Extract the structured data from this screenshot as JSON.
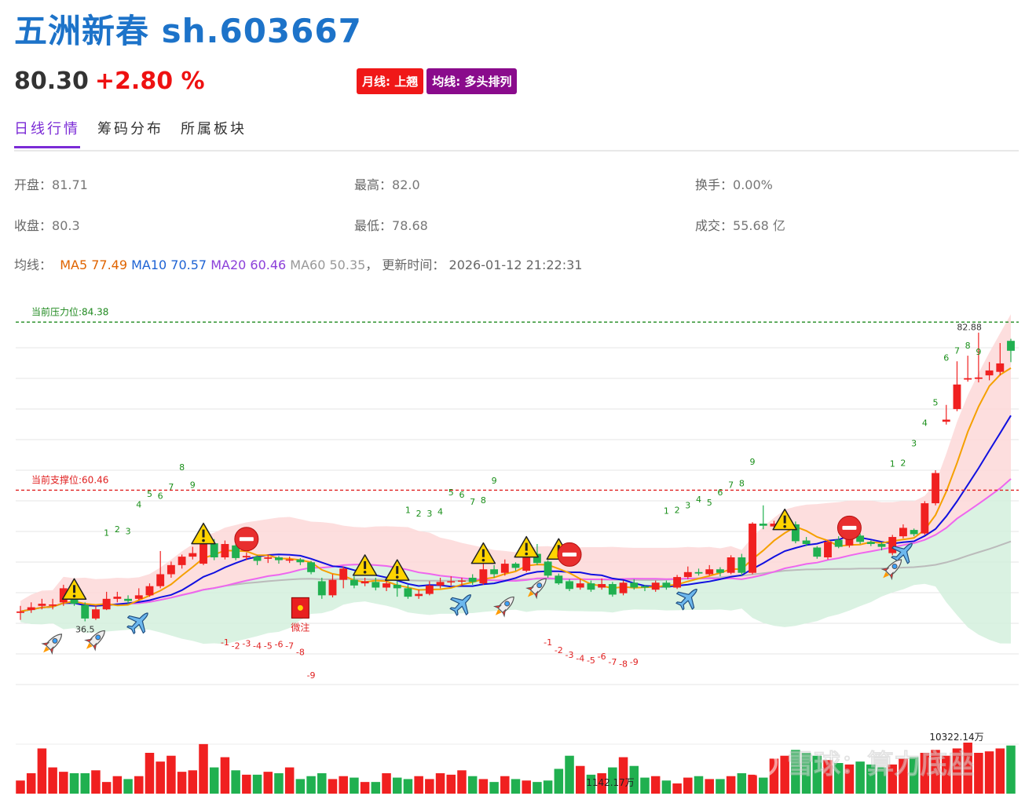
{
  "header": {
    "title": "五洲新春 sh.603667"
  },
  "quote": {
    "price": "80.30",
    "change": "+2.80 %"
  },
  "badges": [
    {
      "label": "月线: 上翘",
      "color": "#f01818"
    },
    {
      "label": "均线: 多头排列",
      "color": "#8a0b8c"
    }
  ],
  "tabs": [
    {
      "label": "日线行情"
    },
    {
      "label": "筹码分布"
    },
    {
      "label": "所属板块"
    }
  ],
  "stats": {
    "open_label": "开盘：",
    "open": "81.71",
    "high_label": "最高：",
    "high": "82.0",
    "turnover_label": "换手：",
    "turnover": "0.00%",
    "close_label": "收盘：",
    "close": "80.3",
    "low_label": "最低：",
    "low": "78.68",
    "amount_label": "成交：",
    "amount": "55.68 亿"
  },
  "ma": {
    "label": "均线：",
    "ma5": "MA5 77.49",
    "ma10": "MA10 70.57",
    "ma20": "MA20 60.46",
    "ma60": "MA60 50.35",
    "sep": "，",
    "update_label": "更新时间：",
    "update_time": "2026-01-12 21:22:31"
  },
  "colors": {
    "up": "#f02020",
    "down": "#20b050",
    "ma5": "#f5a000",
    "ma10": "#1010e0",
    "ma20": "#ee66ee",
    "ma60": "#bbbbbb",
    "resistance": "#208a20",
    "support": "#e02020"
  },
  "chart_data": {
    "type": "candlestick",
    "resistance_label": "当前压力位:84.38",
    "resistance": 84.38,
    "support_label": "当前支撑位:60.46",
    "support": 60.46,
    "y_range": [
      28,
      90
    ],
    "low_label": "36.5",
    "high_label": "82.88",
    "follow_label": "微注",
    "volume_max_label": "10322.14万",
    "volume_min_label": "1142.17万",
    "watermark": "雪球：算力底座",
    "nine_up": [
      {
        "text": "1",
        "i": 8,
        "v": 54
      },
      {
        "text": "2",
        "i": 9,
        "v": 54.5
      },
      {
        "text": "3",
        "i": 10,
        "v": 54.2
      },
      {
        "text": "4",
        "i": 11,
        "v": 58
      },
      {
        "text": "5",
        "i": 12,
        "v": 59.5
      },
      {
        "text": "6",
        "i": 13,
        "v": 59.2
      },
      {
        "text": "7",
        "i": 14,
        "v": 60.5
      },
      {
        "text": "8",
        "i": 15,
        "v": 63.3
      },
      {
        "text": "9",
        "i": 16,
        "v": 60.8
      },
      {
        "text": "1",
        "i": 36,
        "v": 57.2
      },
      {
        "text": "2",
        "i": 37,
        "v": 56.7
      },
      {
        "text": "3",
        "i": 38,
        "v": 56.7
      },
      {
        "text": "4",
        "i": 39,
        "v": 57
      },
      {
        "text": "5",
        "i": 40,
        "v": 59.7
      },
      {
        "text": "6",
        "i": 41,
        "v": 59.4
      },
      {
        "text": "7",
        "i": 42,
        "v": 58.4
      },
      {
        "text": "8",
        "i": 43,
        "v": 58.6
      },
      {
        "text": "9",
        "i": 44,
        "v": 61.4
      },
      {
        "text": "1",
        "i": 60,
        "v": 57.1
      },
      {
        "text": "2",
        "i": 61,
        "v": 57.2
      },
      {
        "text": "3",
        "i": 62,
        "v": 57.9
      },
      {
        "text": "4",
        "i": 63,
        "v": 58.7
      },
      {
        "text": "5",
        "i": 64,
        "v": 58.3
      },
      {
        "text": "6",
        "i": 65,
        "v": 59.7
      },
      {
        "text": "7",
        "i": 66,
        "v": 60.8
      },
      {
        "text": "8",
        "i": 67,
        "v": 61
      },
      {
        "text": "9",
        "i": 68,
        "v": 64.1
      },
      {
        "text": "1",
        "i": 81,
        "v": 63.8
      },
      {
        "text": "2",
        "i": 82,
        "v": 63.9
      },
      {
        "text": "3",
        "i": 83,
        "v": 66.7
      },
      {
        "text": "4",
        "i": 84,
        "v": 69.6
      },
      {
        "text": "5",
        "i": 85,
        "v": 72.5
      },
      {
        "text": "6",
        "i": 86,
        "v": 78.9
      },
      {
        "text": "7",
        "i": 87,
        "v": 79.9
      },
      {
        "text": "8",
        "i": 88,
        "v": 80.6
      },
      {
        "text": "9",
        "i": 89,
        "v": 79.7
      }
    ],
    "nine_down": [
      {
        "text": "-1",
        "i": 19,
        "v": 38.4
      },
      {
        "text": "-2",
        "i": 20,
        "v": 37.9
      },
      {
        "text": "-3",
        "i": 21,
        "v": 38.2
      },
      {
        "text": "-4",
        "i": 22,
        "v": 37.9
      },
      {
        "text": "-5",
        "i": 23,
        "v": 37.9
      },
      {
        "text": "-6",
        "i": 24,
        "v": 38.1
      },
      {
        "text": "-7",
        "i": 25,
        "v": 37.9
      },
      {
        "text": "-8",
        "i": 26,
        "v": 37
      },
      {
        "text": "-9",
        "i": 27,
        "v": 33.7
      },
      {
        "text": "-1",
        "i": 49,
        "v": 38.4
      },
      {
        "text": "-2",
        "i": 50,
        "v": 37.3
      },
      {
        "text": "-3",
        "i": 51,
        "v": 36.6
      },
      {
        "text": "-4",
        "i": 52,
        "v": 36.1
      },
      {
        "text": "-5",
        "i": 53,
        "v": 35.8
      },
      {
        "text": "-6",
        "i": 54,
        "v": 36.4
      },
      {
        "text": "-7",
        "i": 55,
        "v": 35.6
      },
      {
        "text": "-8",
        "i": 56,
        "v": 35.3
      },
      {
        "text": "-9",
        "i": 57,
        "v": 35.6
      }
    ],
    "markers": [
      {
        "type": "warning",
        "i": 5,
        "v": 46.4
      },
      {
        "type": "rocket",
        "i": 3,
        "v": 38.7
      },
      {
        "type": "rocket",
        "i": 7,
        "v": 39.2
      },
      {
        "type": "plane",
        "i": 11,
        "v": 41.7
      },
      {
        "type": "warning",
        "i": 17,
        "v": 54.3
      },
      {
        "type": "stop",
        "i": 21,
        "v": 53.5
      },
      {
        "type": "follow",
        "i": 26,
        "v": 43.6
      },
      {
        "type": "warning",
        "i": 32,
        "v": 49.8
      },
      {
        "type": "warning",
        "i": 35,
        "v": 49.1
      },
      {
        "type": "plane",
        "i": 41,
        "v": 44.3
      },
      {
        "type": "warning",
        "i": 43,
        "v": 51.5
      },
      {
        "type": "rocket",
        "i": 45,
        "v": 44
      },
      {
        "type": "warning",
        "i": 47,
        "v": 52.4
      },
      {
        "type": "rocket",
        "i": 48,
        "v": 46.6
      },
      {
        "type": "warning",
        "i": 50,
        "v": 52.1
      },
      {
        "type": "stop",
        "i": 51,
        "v": 51.3
      },
      {
        "type": "plane",
        "i": 62,
        "v": 45.1
      },
      {
        "type": "warning",
        "i": 71,
        "v": 56.3
      },
      {
        "type": "stop",
        "i": 77,
        "v": 55.1
      },
      {
        "type": "plane",
        "i": 82,
        "v": 51.6
      },
      {
        "type": "rocket",
        "i": 81,
        "v": 49.3
      }
    ],
    "candles": [
      {
        "o": 43,
        "c": 43.2,
        "h": 44,
        "l": 42
      },
      {
        "o": 43.4,
        "c": 43.8,
        "h": 44.5,
        "l": 43
      },
      {
        "o": 44,
        "c": 44.3,
        "h": 45,
        "l": 43.5
      },
      {
        "o": 44,
        "c": 44.2,
        "h": 45,
        "l": 43.5
      },
      {
        "o": 44.5,
        "c": 46.5,
        "h": 47,
        "l": 44
      },
      {
        "o": 46.5,
        "c": 44.3,
        "h": 47,
        "l": 44
      },
      {
        "o": 44.1,
        "c": 42.2,
        "h": 44.5,
        "l": 41.8
      },
      {
        "o": 42.2,
        "c": 43.5,
        "h": 44,
        "l": 42
      },
      {
        "o": 43.5,
        "c": 45,
        "h": 46,
        "l": 43.4
      },
      {
        "o": 45,
        "c": 45.3,
        "h": 46,
        "l": 44.5
      },
      {
        "o": 45,
        "c": 44.7,
        "h": 45.5,
        "l": 44.3
      },
      {
        "o": 45,
        "c": 45.5,
        "h": 46.5,
        "l": 44.8
      },
      {
        "o": 45.5,
        "c": 46.8,
        "h": 47.2,
        "l": 45.3
      },
      {
        "o": 46.8,
        "c": 48.5,
        "h": 51.8,
        "l": 46.5
      },
      {
        "o": 48.5,
        "c": 49.8,
        "h": 50.3,
        "l": 48
      },
      {
        "o": 49.8,
        "c": 51,
        "h": 51.3,
        "l": 49.3
      },
      {
        "o": 51,
        "c": 51.5,
        "h": 52.4,
        "l": 50.6
      },
      {
        "o": 50,
        "c": 53.2,
        "h": 53.8,
        "l": 49.8
      },
      {
        "o": 52.9,
        "c": 50.9,
        "h": 53.5,
        "l": 50.5
      },
      {
        "o": 50.9,
        "c": 52.8,
        "h": 53.3,
        "l": 50.6
      },
      {
        "o": 52.6,
        "c": 50.8,
        "h": 53,
        "l": 50.5
      },
      {
        "o": 50.9,
        "c": 51.1,
        "h": 51.6,
        "l": 50.5
      },
      {
        "o": 51,
        "c": 50.4,
        "h": 51.2,
        "l": 49.8
      },
      {
        "o": 50.7,
        "c": 50.9,
        "h": 51.3,
        "l": 50.1
      },
      {
        "o": 50.9,
        "c": 50.5,
        "h": 51.1,
        "l": 50
      },
      {
        "o": 50.5,
        "c": 50.6,
        "h": 51,
        "l": 50.1
      },
      {
        "o": 50.6,
        "c": 50.2,
        "h": 50.8,
        "l": 49.8
      },
      {
        "o": 50.2,
        "c": 48.8,
        "h": 50.4,
        "l": 48.5
      },
      {
        "o": 47.5,
        "c": 45.5,
        "h": 48,
        "l": 45
      },
      {
        "o": 45.5,
        "c": 47.7,
        "h": 48.5,
        "l": 45.2
      },
      {
        "o": 47.7,
        "c": 49.3,
        "h": 49.6,
        "l": 46.5
      },
      {
        "o": 47.7,
        "c": 46.9,
        "h": 48.2,
        "l": 46.5
      },
      {
        "o": 47.2,
        "c": 47.5,
        "h": 48,
        "l": 46.8
      },
      {
        "o": 47.4,
        "c": 46.6,
        "h": 48,
        "l": 46.2
      },
      {
        "o": 46.6,
        "c": 47.2,
        "h": 47.8,
        "l": 46.1
      },
      {
        "o": 47,
        "c": 46.5,
        "h": 47.5,
        "l": 45.3
      },
      {
        "o": 46.5,
        "c": 45.3,
        "h": 47,
        "l": 45
      },
      {
        "o": 45.4,
        "c": 45.7,
        "h": 46.3,
        "l": 45
      },
      {
        "o": 45.7,
        "c": 46.9,
        "h": 47.5,
        "l": 45.5
      },
      {
        "o": 46.9,
        "c": 47.4,
        "h": 48,
        "l": 46.5
      },
      {
        "o": 47.4,
        "c": 47.5,
        "h": 48.2,
        "l": 46.9
      },
      {
        "o": 47.5,
        "c": 47.6,
        "h": 48,
        "l": 46.8
      },
      {
        "o": 48,
        "c": 47.4,
        "h": 48.5,
        "l": 47
      },
      {
        "o": 47.2,
        "c": 49.2,
        "h": 50,
        "l": 47
      },
      {
        "o": 49.2,
        "c": 48.5,
        "h": 49.8,
        "l": 48
      },
      {
        "o": 48.7,
        "c": 50,
        "h": 50.6,
        "l": 48.3
      },
      {
        "o": 50,
        "c": 49.4,
        "h": 50.2,
        "l": 49
      },
      {
        "o": 49,
        "c": 51.4,
        "h": 51.7,
        "l": 48.8
      },
      {
        "o": 51.4,
        "c": 50.1,
        "h": 52.8,
        "l": 49.8
      },
      {
        "o": 50.3,
        "c": 48.3,
        "h": 50.5,
        "l": 48
      },
      {
        "o": 48.3,
        "c": 47.2,
        "h": 48.6,
        "l": 47
      },
      {
        "o": 47.5,
        "c": 46.4,
        "h": 47.8,
        "l": 46.1
      },
      {
        "o": 46.6,
        "c": 47.2,
        "h": 47.8,
        "l": 46.3
      },
      {
        "o": 47.2,
        "c": 46.3,
        "h": 47.6,
        "l": 46
      },
      {
        "o": 46.6,
        "c": 47.1,
        "h": 47.9,
        "l": 46.3
      },
      {
        "o": 47.1,
        "c": 45.6,
        "h": 47.4,
        "l": 45.3
      },
      {
        "o": 45.8,
        "c": 47.3,
        "h": 47.6,
        "l": 45.5
      },
      {
        "o": 47.3,
        "c": 46.6,
        "h": 47.8,
        "l": 46.3
      },
      {
        "o": 46.8,
        "c": 46.6,
        "h": 47,
        "l": 46.1
      },
      {
        "o": 46.3,
        "c": 47.3,
        "h": 47.6,
        "l": 46
      },
      {
        "o": 47.3,
        "c": 46.6,
        "h": 47.6,
        "l": 46.3
      },
      {
        "o": 46.6,
        "c": 48.1,
        "h": 48.4,
        "l": 46.4
      },
      {
        "o": 48.1,
        "c": 48.8,
        "h": 49.6,
        "l": 47.8
      },
      {
        "o": 48.8,
        "c": 48.6,
        "h": 49.3,
        "l": 48.3
      },
      {
        "o": 48.5,
        "c": 49.2,
        "h": 49.8,
        "l": 48.3
      },
      {
        "o": 49.2,
        "c": 48.7,
        "h": 49.5,
        "l": 48.2
      },
      {
        "o": 48.7,
        "c": 50.9,
        "h": 51.2,
        "l": 48.5
      },
      {
        "o": 50.9,
        "c": 48.7,
        "h": 51.4,
        "l": 48.3
      },
      {
        "o": 48.7,
        "c": 55.7,
        "h": 55.9,
        "l": 48.5
      },
      {
        "o": 55.7,
        "c": 55.4,
        "h": 58.3,
        "l": 54.9
      },
      {
        "o": 55.3,
        "c": 55.7,
        "h": 56.1,
        "l": 54.9
      },
      {
        "o": 55.7,
        "c": 56.3,
        "h": 56.8,
        "l": 55.3
      },
      {
        "o": 55.6,
        "c": 53.2,
        "h": 56,
        "l": 52.9
      },
      {
        "o": 53.3,
        "c": 52.8,
        "h": 53.8,
        "l": 52.5
      },
      {
        "o": 52.3,
        "c": 51,
        "h": 52.5,
        "l": 50.7
      },
      {
        "o": 50.9,
        "c": 53.1,
        "h": 53.4,
        "l": 50.6
      },
      {
        "o": 53.4,
        "c": 52.4,
        "h": 53.9,
        "l": 52.2
      },
      {
        "o": 52.6,
        "c": 54,
        "h": 54.3,
        "l": 52.3
      },
      {
        "o": 54,
        "c": 53.1,
        "h": 54.3,
        "l": 52.8
      },
      {
        "o": 53.1,
        "c": 52.8,
        "h": 53.3,
        "l": 52.5
      },
      {
        "o": 52.8,
        "c": 52.4,
        "h": 53,
        "l": 51.9
      },
      {
        "o": 51.5,
        "c": 53.8,
        "h": 54.1,
        "l": 51.2
      },
      {
        "o": 53.9,
        "c": 55.1,
        "h": 55.6,
        "l": 53.6
      },
      {
        "o": 54.8,
        "c": 54.2,
        "h": 55,
        "l": 53.9
      },
      {
        "o": 54.3,
        "c": 58.6,
        "h": 58.9,
        "l": 54.1
      },
      {
        "o": 58.6,
        "c": 62.9,
        "h": 63.3,
        "l": 58.3
      },
      {
        "o": 70.2,
        "c": 70.5,
        "h": 72.6,
        "l": 69.8
      },
      {
        "o": 72,
        "c": 75.5,
        "h": 78.8,
        "l": 71.7
      },
      {
        "o": 76.2,
        "c": 76.4,
        "h": 79.6,
        "l": 75.9
      },
      {
        "o": 76.3,
        "c": 76.5,
        "h": 82.88,
        "l": 75.8
      },
      {
        "o": 76.8,
        "c": 77.5,
        "h": 78.7,
        "l": 76.1
      },
      {
        "o": 77.3,
        "c": 78.5,
        "h": 81.4,
        "l": 76.8
      },
      {
        "o": 81.71,
        "c": 80.3,
        "h": 82,
        "l": 78.68
      }
    ],
    "volumes": [
      9,
      14,
      31,
      18,
      15,
      14,
      14,
      16,
      8,
      12,
      10,
      12,
      28,
      22,
      26,
      15,
      16,
      34,
      18,
      25,
      16,
      13,
      13,
      15,
      14,
      18,
      10,
      12,
      14,
      10,
      12,
      11,
      8,
      8,
      14,
      11,
      10,
      12,
      10,
      14,
      13,
      16,
      12,
      10,
      8,
      12,
      10,
      9,
      8,
      9,
      17,
      26,
      19,
      13,
      14,
      18,
      25,
      19,
      11,
      12,
      9,
      7,
      11,
      12,
      10,
      10,
      12,
      14,
      13,
      11,
      24,
      26,
      30,
      28,
      26,
      23,
      21,
      20,
      22,
      20,
      18,
      20,
      24,
      25,
      28,
      30,
      26,
      31,
      35,
      28,
      29,
      31,
      33
    ]
  }
}
